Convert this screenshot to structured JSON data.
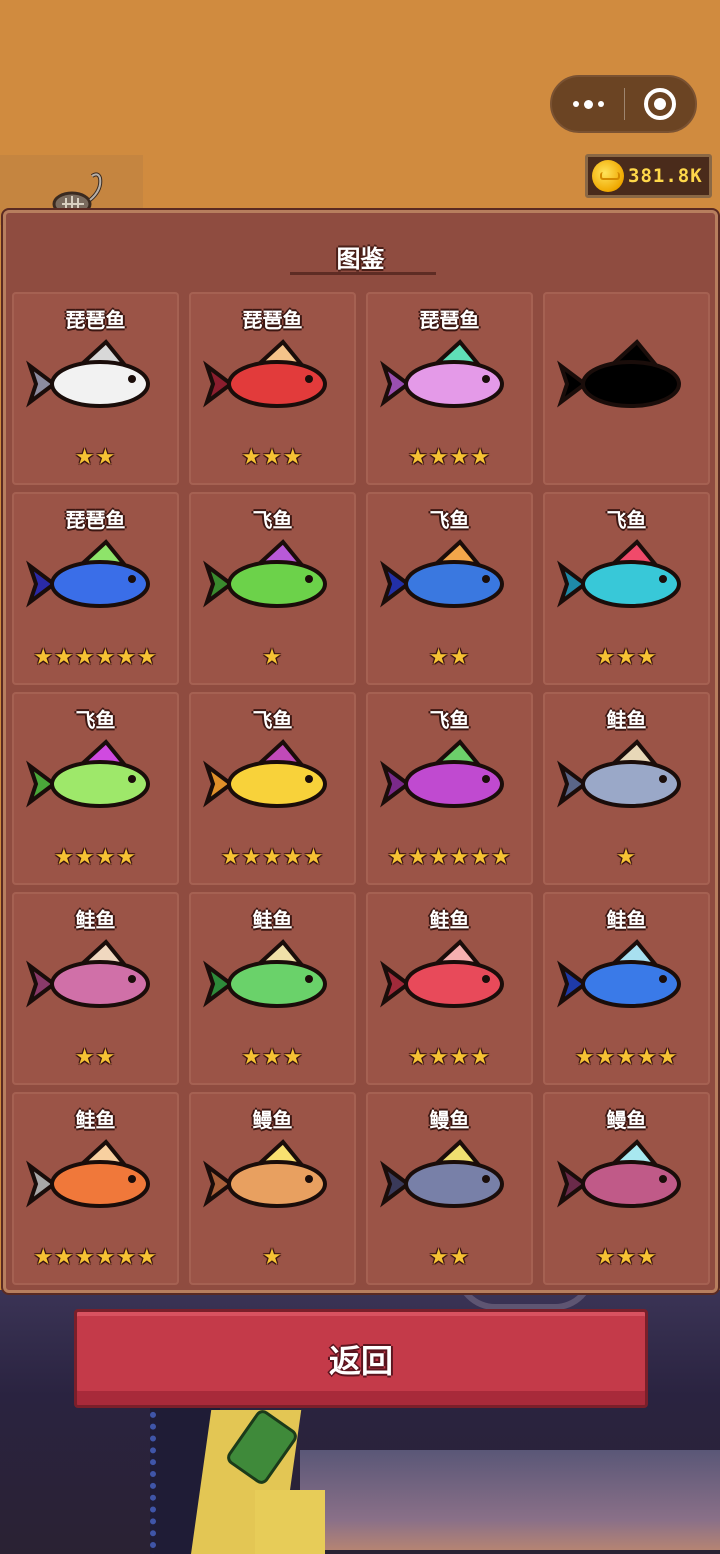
{
  "capsule": {
    "more_icon": "more-dots-icon",
    "close_icon": "target-close-icon"
  },
  "coins": {
    "icon": "gold-coin-icon",
    "value": "381.8K"
  },
  "panel": {
    "title": "图鉴"
  },
  "fishes": [
    {
      "name": "琵琶鱼",
      "stars": 2,
      "unlocked": true,
      "body": "#f2f2f2",
      "fin": "#d8d8d8",
      "accent": "#8c8ca0"
    },
    {
      "name": "琵琶鱼",
      "stars": 3,
      "unlocked": true,
      "body": "#e23b3b",
      "fin": "#f4c38a",
      "accent": "#8a1e2e"
    },
    {
      "name": "琵琶鱼",
      "stars": 4,
      "unlocked": true,
      "body": "#e49ae8",
      "fin": "#5fe0b8",
      "accent": "#9a4fb0"
    },
    {
      "name": "",
      "stars": 0,
      "unlocked": false,
      "body": "#000000",
      "fin": "#000000",
      "accent": "#000000"
    },
    {
      "name": "琵琶鱼",
      "stars": 6,
      "unlocked": true,
      "body": "#3a6ee8",
      "fin": "#8ee46a",
      "accent": "#2a2aa8"
    },
    {
      "name": "飞鱼",
      "stars": 1,
      "unlocked": true,
      "body": "#6cd24a",
      "fin": "#b85ad8",
      "accent": "#3a8a2e"
    },
    {
      "name": "飞鱼",
      "stars": 2,
      "unlocked": true,
      "body": "#3a78e0",
      "fin": "#f2a64a",
      "accent": "#2230a8"
    },
    {
      "name": "飞鱼",
      "stars": 3,
      "unlocked": true,
      "body": "#38c8d8",
      "fin": "#f04a6a",
      "accent": "#1e8aa8"
    },
    {
      "name": "飞鱼",
      "stars": 4,
      "unlocked": true,
      "body": "#9ee86a",
      "fin": "#d04ae0",
      "accent": "#4aa83a"
    },
    {
      "name": "飞鱼",
      "stars": 5,
      "unlocked": true,
      "body": "#f8d23a",
      "fin": "#c04ab8",
      "accent": "#e0902a"
    },
    {
      "name": "飞鱼",
      "stars": 6,
      "unlocked": true,
      "body": "#c04ad0",
      "fin": "#6ccf6a",
      "accent": "#7a2a8a"
    },
    {
      "name": "鲑鱼",
      "stars": 1,
      "unlocked": true,
      "body": "#9aa8c8",
      "fin": "#e8d8b8",
      "accent": "#5a6688"
    },
    {
      "name": "鲑鱼",
      "stars": 2,
      "unlocked": true,
      "body": "#d070a8",
      "fin": "#f0d8c0",
      "accent": "#8a3a6a"
    },
    {
      "name": "鲑鱼",
      "stars": 3,
      "unlocked": true,
      "body": "#6ad26a",
      "fin": "#f0e0a8",
      "accent": "#2e8a3a"
    },
    {
      "name": "鲑鱼",
      "stars": 4,
      "unlocked": true,
      "body": "#e84a5a",
      "fin": "#f6b0b0",
      "accent": "#a02a3a"
    },
    {
      "name": "鲑鱼",
      "stars": 5,
      "unlocked": true,
      "body": "#3a7ae8",
      "fin": "#a8e0f0",
      "accent": "#1e3aa8"
    },
    {
      "name": "鲑鱼",
      "stars": 6,
      "unlocked": true,
      "body": "#f0783a",
      "fin": "#f8d0a0",
      "accent": "#a8a8a8"
    },
    {
      "name": "鳗鱼",
      "stars": 1,
      "unlocked": true,
      "body": "#e8a060",
      "fin": "#f8e070",
      "accent": "#a8603a"
    },
    {
      "name": "鳗鱼",
      "stars": 2,
      "unlocked": true,
      "body": "#7880a8",
      "fin": "#f0e070",
      "accent": "#3a3a5a"
    },
    {
      "name": "鳗鱼",
      "stars": 3,
      "unlocked": true,
      "body": "#c05a88",
      "fin": "#a8e8f0",
      "accent": "#6a2a4a"
    }
  ],
  "back_button": {
    "label": "返回"
  }
}
